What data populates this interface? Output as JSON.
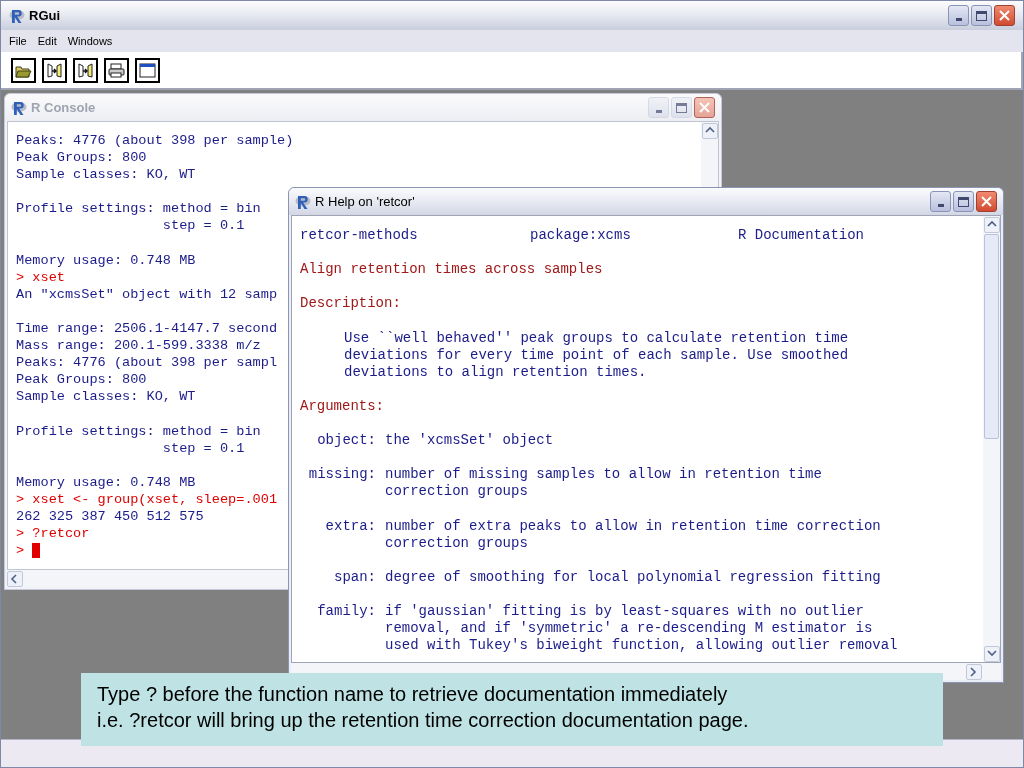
{
  "window": {
    "title": "RGui"
  },
  "menu": [
    "File",
    "Edit",
    "Windows"
  ],
  "console": {
    "title": "R Console",
    "active": false,
    "lines": [
      {
        "kind": "output",
        "text": "Peaks: 4776 (about 398 per sample)"
      },
      {
        "kind": "output",
        "text": "Peak Groups: 800"
      },
      {
        "kind": "output",
        "text": "Sample classes: KO, WT"
      },
      {
        "kind": "blank"
      },
      {
        "kind": "output",
        "text": "Profile settings: method = bin"
      },
      {
        "kind": "output",
        "text": "                  step = 0.1"
      },
      {
        "kind": "blank"
      },
      {
        "kind": "output",
        "text": "Memory usage: 0.748 MB"
      },
      {
        "kind": "input",
        "text": "> xset"
      },
      {
        "kind": "output",
        "text": "An \"xcmsSet\" object with 12 samp"
      },
      {
        "kind": "blank"
      },
      {
        "kind": "output",
        "text": "Time range: 2506.1-4147.7 second"
      },
      {
        "kind": "output",
        "text": "Mass range: 200.1-599.3338 m/z"
      },
      {
        "kind": "output",
        "text": "Peaks: 4776 (about 398 per sampl"
      },
      {
        "kind": "output",
        "text": "Peak Groups: 800"
      },
      {
        "kind": "output",
        "text": "Sample classes: KO, WT"
      },
      {
        "kind": "blank"
      },
      {
        "kind": "output",
        "text": "Profile settings: method = bin"
      },
      {
        "kind": "output",
        "text": "                  step = 0.1"
      },
      {
        "kind": "blank"
      },
      {
        "kind": "output",
        "text": "Memory usage: 0.748 MB"
      },
      {
        "kind": "input",
        "text": "> xset <- group(xset, sleep=.001"
      },
      {
        "kind": "output",
        "text": "262 325 387 450 512 575"
      },
      {
        "kind": "input",
        "text": "> ?retcor"
      },
      {
        "kind": "prompt",
        "text": ">"
      }
    ]
  },
  "help": {
    "title": "R Help on 'retcor'",
    "active": true,
    "lines": [
      {
        "kind": "header",
        "texts": [
          "retcor-methods",
          "package:xcms",
          "R Documentation"
        ]
      },
      {
        "kind": "blank"
      },
      {
        "kind": "heading",
        "text": "Align retention times across samples"
      },
      {
        "kind": "blank"
      },
      {
        "kind": "heading",
        "text": "Description:"
      },
      {
        "kind": "blank"
      },
      {
        "kind": "para",
        "text": "Use ``well behaved'' peak groups to calculate retention time"
      },
      {
        "kind": "para",
        "text": "deviations for every time point of each sample. Use smoothed"
      },
      {
        "kind": "para",
        "text": "deviations to align retention times."
      },
      {
        "kind": "blank"
      },
      {
        "kind": "heading",
        "text": "Arguments:"
      },
      {
        "kind": "blank"
      },
      {
        "kind": "arg",
        "name": "object:",
        "text": "the 'xcmsSet' object"
      },
      {
        "kind": "blank"
      },
      {
        "kind": "arg",
        "name": "missing:",
        "text": "number of missing samples to allow in retention time"
      },
      {
        "kind": "arg",
        "text": "correction groups"
      },
      {
        "kind": "blank"
      },
      {
        "kind": "arg",
        "name": "extra:",
        "text": "number of extra peaks to allow in retention time correction"
      },
      {
        "kind": "arg",
        "text": "correction groups"
      },
      {
        "kind": "blank"
      },
      {
        "kind": "arg",
        "name": "span:",
        "text": "degree of smoothing for local polynomial regression fitting"
      },
      {
        "kind": "blank"
      },
      {
        "kind": "arg",
        "name": "family:",
        "text": "if 'gaussian' fitting is by least-squares with no outlier"
      },
      {
        "kind": "arg",
        "text": "removal, and if 'symmetric' a re-descending M estimator is"
      },
      {
        "kind": "arg",
        "text": "used with Tukey's biweight function, allowing outlier removal"
      }
    ]
  },
  "caption": [
    "Type ? before the function name to retrieve documentation immediately",
    "i.e. ?retcor will bring up the retention time correction documentation page."
  ]
}
